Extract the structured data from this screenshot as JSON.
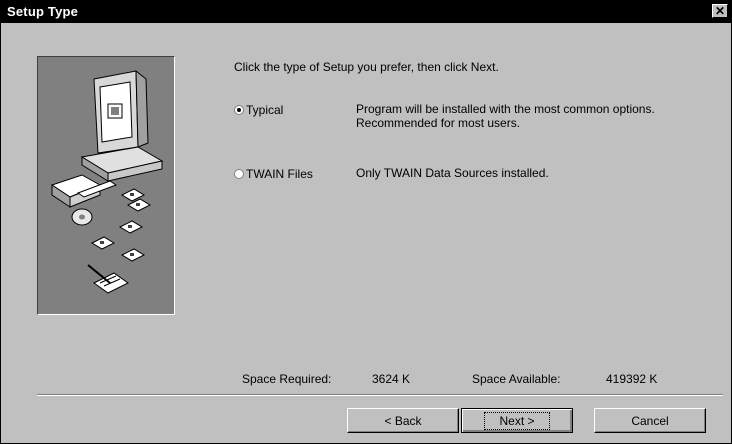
{
  "window": {
    "title": "Setup Type",
    "close_glyph": "✕"
  },
  "main": {
    "intro": "Click the type of Setup you prefer, then click Next.",
    "options": [
      {
        "label": "Typical",
        "selected": true,
        "description_line1": "Program will be installed with the most common options.",
        "description_line2": "Recommended for most users."
      },
      {
        "label": "TWAIN Files",
        "selected": false,
        "description_line1": "Only TWAIN Data Sources installed."
      }
    ],
    "space": {
      "required_label": "Space Required:",
      "required_value": "3624 K",
      "available_label": "Space Available:",
      "available_value": "419392 K"
    }
  },
  "buttons": {
    "back": "< Back",
    "next": "Next >",
    "cancel": "Cancel"
  },
  "icons": {
    "illustration": "computer-disks-illustration-icon",
    "close": "close-icon"
  },
  "colors": {
    "face": "#c0c0c0",
    "title_bar": "#000000",
    "panel": "#808080"
  }
}
